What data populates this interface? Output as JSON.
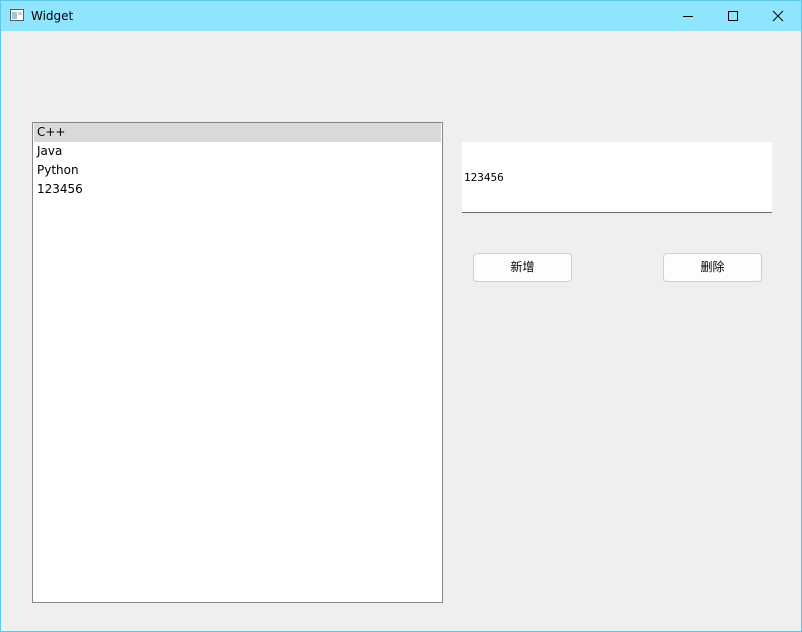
{
  "window": {
    "title": "Widget",
    "controls": {
      "minimize": "minimize-icon",
      "maximize": "maximize-icon",
      "close": "close-icon"
    }
  },
  "list": {
    "items": [
      {
        "label": "C++",
        "selected": true
      },
      {
        "label": "Java",
        "selected": false
      },
      {
        "label": "Python",
        "selected": false
      },
      {
        "label": "123456",
        "selected": false
      }
    ]
  },
  "text_edit": {
    "value": "123456"
  },
  "buttons": {
    "add_label": "新增",
    "delete_label": "删除"
  },
  "colors": {
    "titlebar": "#8fe4fe",
    "window_bg": "#efefef",
    "selection": "#d9d9d9"
  }
}
